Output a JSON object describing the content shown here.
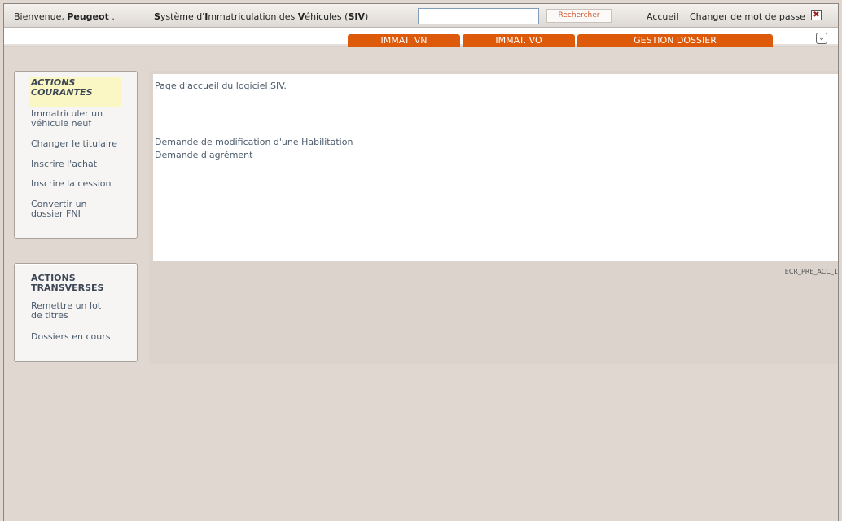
{
  "header": {
    "welcome_prefix": "Bienvenue,",
    "user_name": "Peugeot",
    "user_suffix": ".",
    "title_parts": [
      {
        "text": "S",
        "bold": true
      },
      {
        "text": "ystème d'",
        "bold": false
      },
      {
        "text": "I",
        "bold": true
      },
      {
        "text": "mmatriculation des ",
        "bold": false
      },
      {
        "text": "V",
        "bold": true
      },
      {
        "text": "éhicules (",
        "bold": false
      },
      {
        "text": "SIV",
        "bold": true
      },
      {
        "text": ")",
        "bold": false
      }
    ],
    "search_value": "",
    "search_button": "Rechercher",
    "link_home": "Accueil",
    "link_password": "Changer de mot de passe",
    "close_glyph": "✖"
  },
  "nav": {
    "tabs": [
      "IMMAT. VN",
      "IMMAT. VO",
      "GESTION DOSSIER"
    ],
    "expand_glyph": "⌄"
  },
  "sidebar": {
    "current": {
      "title_line1": "ACTIONS",
      "title_line2": "COURANTES",
      "items": [
        [
          "Immatriculer un",
          "véhicule neuf"
        ],
        [
          "Changer le titulaire"
        ],
        [
          "Inscrire l'achat"
        ],
        [
          "Inscrire la cession"
        ],
        [
          "Convertir un",
          "dossier FNI"
        ]
      ]
    },
    "transverse": {
      "title_line1": "ACTIONS",
      "title_line2": "TRANSVERSES",
      "items": [
        [
          "Remettre un lot",
          "de titres"
        ],
        [
          "Dossiers en cours"
        ]
      ]
    }
  },
  "main": {
    "intro": "Page d'accueil du logiciel SIV.",
    "link_habilitation": "Demande de modification d'une Habilitation",
    "link_agrement": "Demande d'agrément",
    "screen_code": "ECR_PRE_ACC_1"
  },
  "colors": {
    "tab_orange": "#dd5a0a",
    "search_button_text": "#d2542a",
    "highlight": "#fbf7c4"
  }
}
